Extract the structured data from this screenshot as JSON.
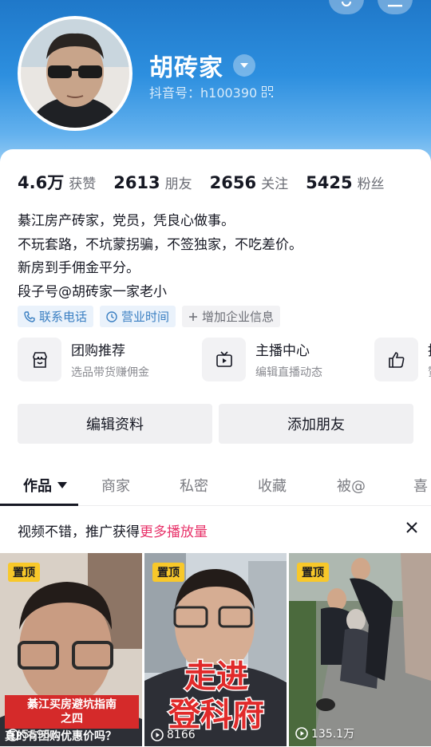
{
  "profile": {
    "name": "胡砖家",
    "douyin_id": "抖音号：h100390"
  },
  "stats": [
    {
      "num": "4.6万",
      "label": "获赞"
    },
    {
      "num": "2613",
      "label": "朋友"
    },
    {
      "num": "2656",
      "label": "关注"
    },
    {
      "num": "5425",
      "label": "粉丝"
    }
  ],
  "bio": [
    "綦江房产砖家，党员，凭良心做事。",
    "不玩套路，不坑蒙拐骗，不签独家，不吃差价。",
    "新房到手佣金平分。",
    "段子号@胡砖家一家老小"
  ],
  "tags": [
    {
      "label": "联系电话",
      "icon": "phone-icon"
    },
    {
      "label": "营业时间",
      "icon": "clock-icon"
    },
    {
      "label": "增加企业信息",
      "icon": "plus-icon"
    }
  ],
  "services": [
    {
      "title": "团购推荐",
      "sub": "选品带货赚佣金",
      "icon": "shop-icon"
    },
    {
      "title": "主播中心",
      "sub": "编辑直播动态",
      "icon": "tv-icon"
    },
    {
      "title": "推",
      "sub": "赞",
      "icon": "thumbs-up-icon"
    }
  ],
  "actions": {
    "edit": "编辑资料",
    "add_friend": "添加朋友"
  },
  "tabs": [
    "作品",
    "商家",
    "私密",
    "收藏",
    "被@",
    "喜"
  ],
  "promo": {
    "prefix": "视频不错，推广获得",
    "highlight": "更多播放量"
  },
  "videos": [
    {
      "pin": "置顶",
      "plays": "5595",
      "caption_line1": "綦江买房避坑指南",
      "caption_line2": "之四",
      "caption_line3": "真的有团购优惠价吗？"
    },
    {
      "pin": "置顶",
      "plays": "8166",
      "caption_line1": "走进",
      "caption_line2": "登科府"
    },
    {
      "pin": "置顶",
      "plays": "135.1万"
    }
  ],
  "colors": {
    "accent": "#e8336a",
    "pin": "#f8c82a",
    "header": "#2d8fdf"
  }
}
